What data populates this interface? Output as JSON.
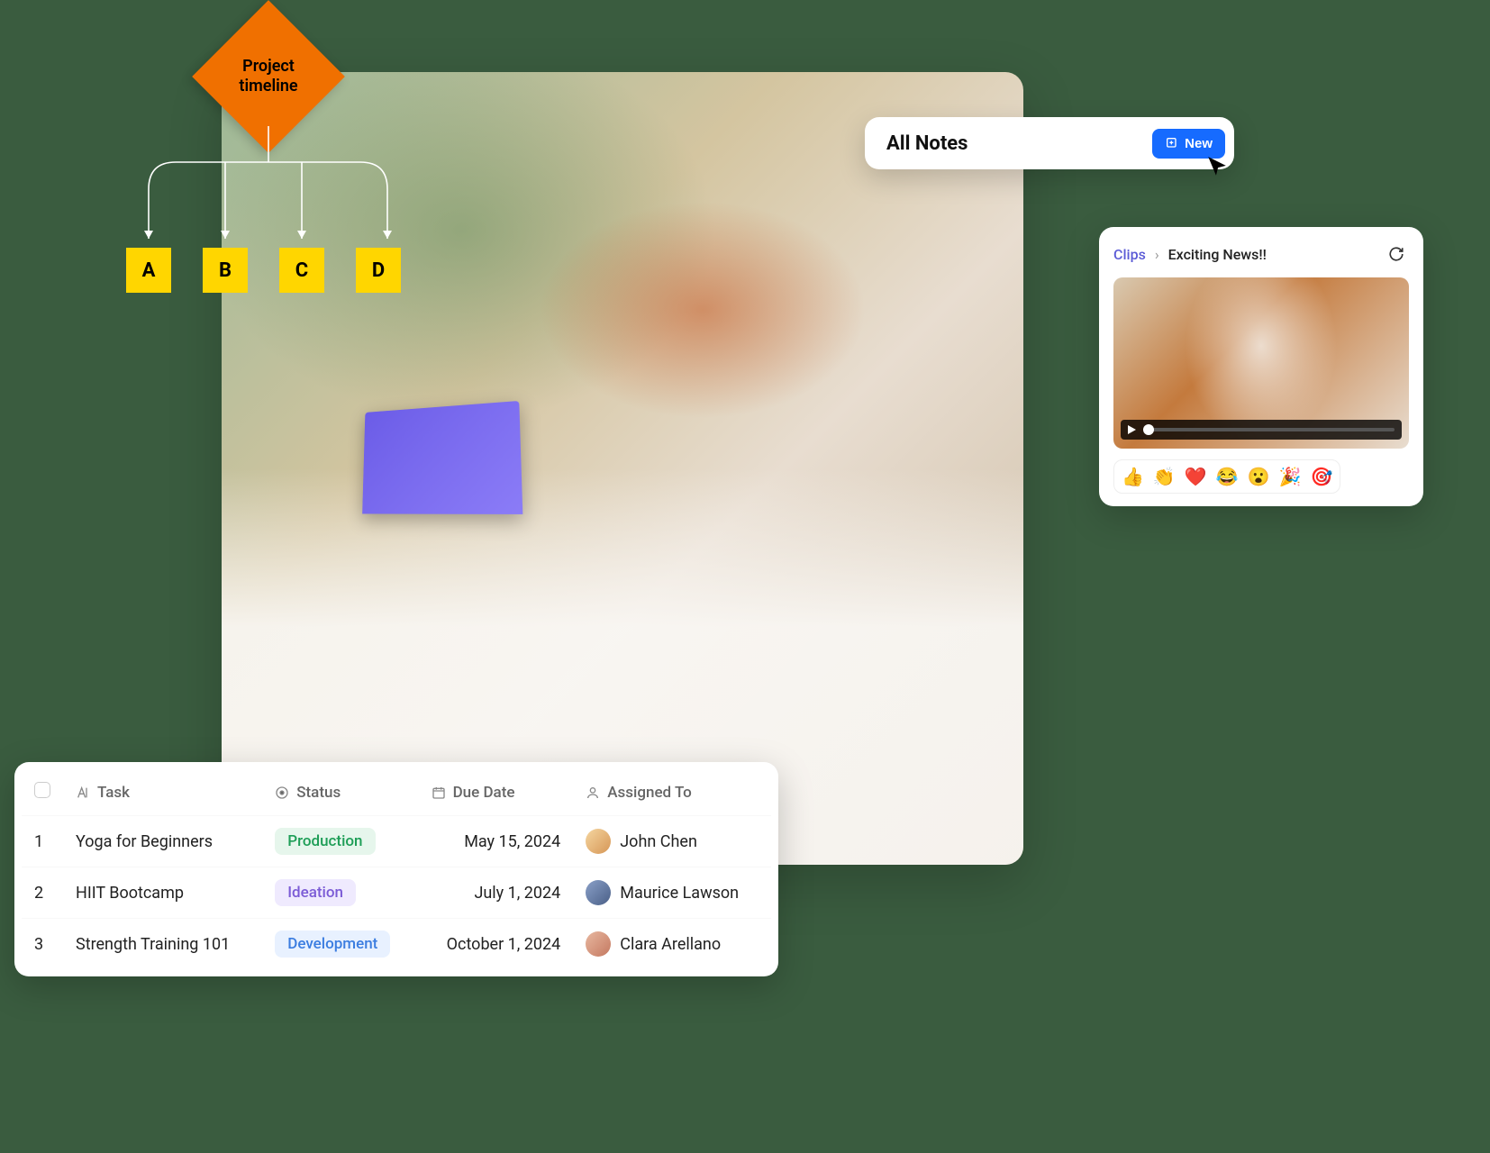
{
  "flow": {
    "title_line1": "Project",
    "title_line2": "timeline",
    "nodes": [
      "A",
      "B",
      "C",
      "D"
    ]
  },
  "notes": {
    "title": "All Notes",
    "new_button": "New"
  },
  "clips": {
    "root": "Clips",
    "separator": "›",
    "current": "Exciting News!!"
  },
  "reactions": [
    "👍",
    "👏",
    "❤️",
    "😂",
    "😮",
    "🎉",
    "🎯"
  ],
  "table": {
    "headers": {
      "task": "Task",
      "status": "Status",
      "due": "Due Date",
      "assignee": "Assigned To"
    },
    "rows": [
      {
        "num": "1",
        "task": "Yoga for Beginners",
        "status": "Production",
        "status_class": "st-production",
        "due": "May 15, 2024",
        "assignee": "John Chen",
        "av": "av-1"
      },
      {
        "num": "2",
        "task": "HIIT Bootcamp",
        "status": "Ideation",
        "status_class": "st-ideation",
        "due": "July 1, 2024",
        "assignee": "Maurice Lawson",
        "av": "av-2"
      },
      {
        "num": "3",
        "task": "Strength Training 101",
        "status": "Development",
        "status_class": "st-development",
        "due": "October 1, 2024",
        "assignee": "Clara Arellano",
        "av": "av-3"
      }
    ]
  }
}
